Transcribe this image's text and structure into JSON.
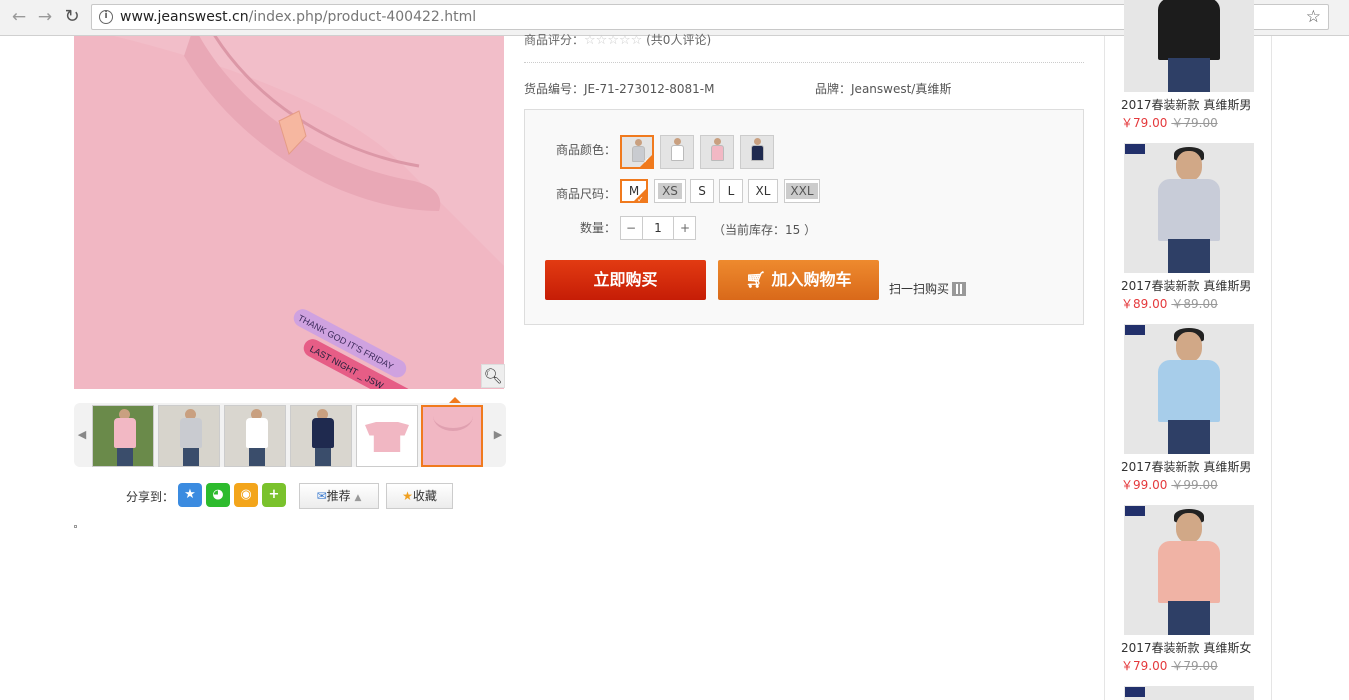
{
  "browser": {
    "url_host": "www.jeanswest.cn",
    "url_path": "/index.php/product-400422.html"
  },
  "gallery": {
    "shirt_color": "#f1b7c3",
    "patch_text_1": "THANK GOD IT'S FRIDAY",
    "patch_text_2": "LAST NIGHT _ JSW",
    "thumbnails": [
      {
        "body": "#f2b8c4",
        "bg": "#6a8a4a"
      },
      {
        "body": "#c9cbd0",
        "bg": "#d7d4cc"
      },
      {
        "body": "#ffffff",
        "bg": "#d9d6cf"
      },
      {
        "body": "#1f2a4f",
        "bg": "#d9d6cf"
      },
      {
        "body": "#f1b7c3",
        "bg": "#ffffff"
      },
      {
        "body": "#f1b7c3",
        "bg": "#f1b7c3"
      }
    ]
  },
  "share": {
    "label": "分享到：",
    "recommend": "推荐",
    "favorite": "收藏"
  },
  "product": {
    "rating_label": "商品评分：",
    "rating_count": "(共0人评论)",
    "sku_label": "货品编号：",
    "sku": "JE-71-273012-8081-M",
    "brand_label": "品牌：",
    "brand": "Jeanswest/真维斯",
    "color_label": "商品颜色：",
    "colors": [
      "#c9cbd0",
      "#ffffff",
      "#f2b8c4",
      "#1f2a4f"
    ],
    "size_label": "商品尺码：",
    "sizes": [
      "M",
      "XS",
      "S",
      "L",
      "XL",
      "XXL"
    ],
    "qty_label": "数量：",
    "qty": "1",
    "qty_minus": "−",
    "qty_plus": "+",
    "stock_text": "（当前库存：15 ）",
    "buy_now": "立即购买",
    "add_cart": "加入购物车",
    "scan_buy": "扫一扫购买"
  },
  "recommendations": [
    {
      "name": "2017春装新款 真维斯男",
      "price": "￥79.00",
      "old_price": "￥79.00",
      "color": "#1c1c1c"
    },
    {
      "name": "2017春装新款 真维斯男",
      "price": "￥89.00",
      "old_price": "￥89.00",
      "color": "#c8ccd8"
    },
    {
      "name": "2017春装新款 真维斯男",
      "price": "￥99.00",
      "old_price": "￥99.00",
      "color": "#a7cdea"
    },
    {
      "name": "2017春装新款 真维斯女",
      "price": "￥79.00",
      "old_price": "￥79.00",
      "color": "#f0b3a5"
    }
  ]
}
